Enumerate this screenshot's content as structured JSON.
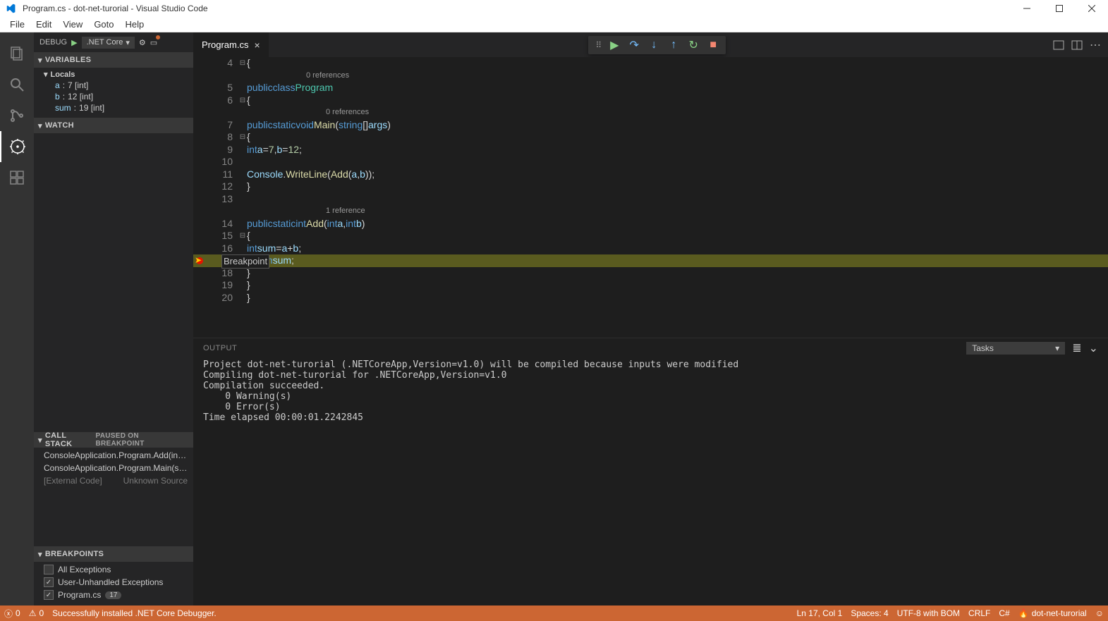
{
  "titlebar": {
    "title": "Program.cs - dot-net-turorial - Visual Studio Code"
  },
  "menu": [
    "File",
    "Edit",
    "View",
    "Goto",
    "Help"
  ],
  "debugHeader": {
    "label": "DEBUG",
    "config": ".NET Core"
  },
  "sections": {
    "variables": "VARIABLES",
    "locals": "Locals",
    "watch": "WATCH",
    "callstack": "CALL STACK",
    "callstackStatus": "PAUSED ON BREAKPOINT",
    "breakpoints": "BREAKPOINTS"
  },
  "locals": [
    {
      "name": "a",
      "value": "7 [int]"
    },
    {
      "name": "b",
      "value": "12 [int]"
    },
    {
      "name": "sum",
      "value": "19 [int]"
    }
  ],
  "callstack": [
    {
      "label": "ConsoleApplication.Program.Add(in…",
      "dim": false
    },
    {
      "label": "ConsoleApplication.Program.Main(s…",
      "dim": false
    },
    {
      "label": "[External Code]",
      "right": "Unknown Source",
      "dim": true
    }
  ],
  "breakpoints": [
    {
      "label": "All Exceptions",
      "checked": false
    },
    {
      "label": "User-Unhandled Exceptions",
      "checked": true
    },
    {
      "label": "Program.cs",
      "checked": true,
      "badge": "17"
    }
  ],
  "tab": {
    "name": "Program.cs"
  },
  "editor": {
    "breakpointLabel": "Breakpoint",
    "linesStart": 4,
    "codelens0": "0 references",
    "codelens1": "1 reference",
    "highlightLine": 17
  },
  "codeLines": [
    {
      "n": 4,
      "fold": "⊟",
      "html": "<span class='pun'>{</span>"
    },
    {
      "codelens": "0 references",
      "indent": 12
    },
    {
      "n": 5,
      "html": "    <span class='kw'>public</span> <span class='kw'>class</span> <span class='type'>Program</span>"
    },
    {
      "n": 6,
      "fold": "⊟",
      "html": "    <span class='pun'>{</span>"
    },
    {
      "codelens": "0 references",
      "indent": 16
    },
    {
      "n": 7,
      "html": "        <span class='kw'>public</span> <span class='kw'>static</span> <span class='kw'>void</span> <span class='fn'>Main</span><span class='pun'>(</span><span class='kw'>string</span><span class='pun'>[]</span> <span class='var'>args</span><span class='pun'>)</span>"
    },
    {
      "n": 8,
      "fold": "⊟",
      "html": "        <span class='pun'>{</span>"
    },
    {
      "n": 9,
      "html": "            <span class='kw'>int</span> <span class='var'>a</span> <span class='pun'>=</span> <span class='num'>7</span><span class='pun'>,</span> <span class='var'>b</span> <span class='pun'>=</span> <span class='num'>12</span><span class='pun'>;</span>"
    },
    {
      "n": 10,
      "html": ""
    },
    {
      "n": 11,
      "html": "            <span class='var'>Console</span><span class='pun'>.</span><span class='fn'>WriteLine</span><span class='pun'>(</span><span class='fn'>Add</span><span class='pun'>(</span><span class='var'>a</span><span class='pun'>,</span> <span class='var'>b</span><span class='pun'>));</span>"
    },
    {
      "n": 12,
      "html": "        <span class='pun'>}</span>"
    },
    {
      "n": 13,
      "html": ""
    },
    {
      "codelens": "1 reference",
      "indent": 16
    },
    {
      "n": 14,
      "html": "        <span class='kw'>public</span> <span class='kw'>static</span> <span class='kw'>int</span> <span class='fn'>Add</span><span class='pun'>(</span><span class='kw'>int</span> <span class='var'>a</span><span class='pun'>,</span> <span class='kw'>int</span> <span class='var'>b</span><span class='pun'>)</span>"
    },
    {
      "n": 15,
      "fold": "⊟",
      "html": "        <span class='pun'>{</span>"
    },
    {
      "n": 16,
      "html": "            <span class='kw'>int</span> <span class='var'>sum</span> <span class='pun'>=</span> <span class='var'>a</span> <span class='pun'>+</span> <span class='var'>b</span><span class='pun'>;</span>"
    },
    {
      "n": 17,
      "bp": true,
      "hl": true,
      "html": "            <span class='kw'>return</span> <span class='var'>sum</span><span class='pun'>;</span>"
    },
    {
      "n": 18,
      "html": "        <span class='pun'>}</span>"
    },
    {
      "n": 19,
      "html": "    <span class='pun'>}</span>"
    },
    {
      "n": 20,
      "html": "<span class='pun'>}</span>"
    }
  ],
  "panel": {
    "title": "OUTPUT",
    "dropdown": "Tasks",
    "text": "Project dot-net-turorial (.NETCoreApp,Version=v1.0) will be compiled because inputs were modified\nCompiling dot-net-turorial for .NETCoreApp,Version=v1.0\nCompilation succeeded.\n    0 Warning(s)\n    0 Error(s)\nTime elapsed 00:00:01.2242845"
  },
  "statusbar": {
    "errors": "0",
    "warnings": "0",
    "msg": "Successfully installed .NET Core Debugger.",
    "pos": "Ln 17, Col 1",
    "spaces": "Spaces: 4",
    "encoding": "UTF-8 with BOM",
    "eol": "CRLF",
    "lang": "C#",
    "project": "dot-net-turorial"
  }
}
